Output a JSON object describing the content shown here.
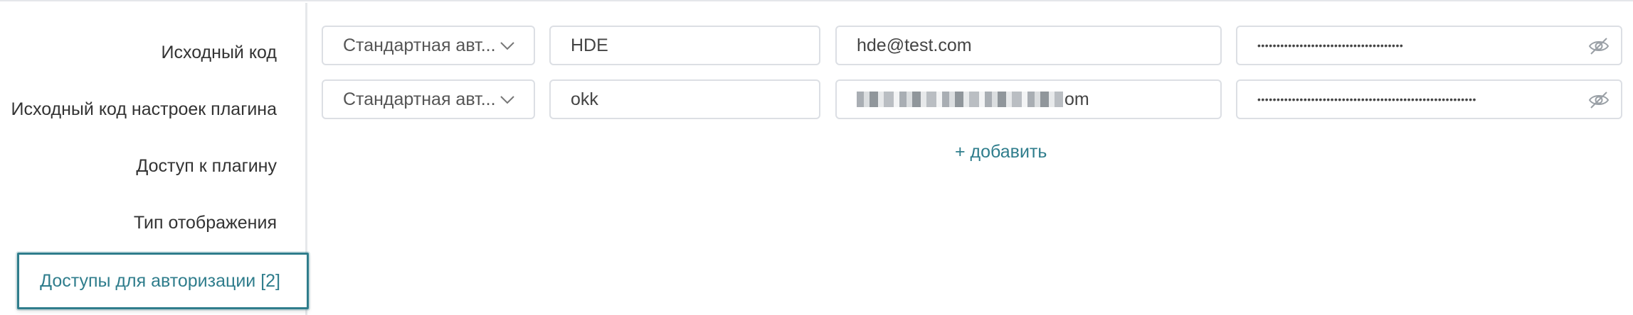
{
  "nav": {
    "items": [
      {
        "label": "Исходный код"
      },
      {
        "label": "Исходный код настроек плагина"
      },
      {
        "label": "Доступ к плагину"
      },
      {
        "label": "Тип отображения"
      }
    ],
    "active_label": "Доступы для авторизации [2]"
  },
  "credentials": [
    {
      "auth_type": "Стандартная авт...",
      "name": "HDE",
      "login": "hde@test.com",
      "password_mask": "••••••••••••••••••••••••••••••••••••••",
      "password_icon": "eye-slash-icon"
    },
    {
      "auth_type": "Стандартная авт...",
      "name": "okk",
      "login_suffix": "om",
      "password_mask": "•••••••••••••••••••••••••••••••••••••••••••••••••••••••••",
      "password_icon": "eye-slash-icon"
    }
  ],
  "add_label": "+ добавить",
  "colors": {
    "accent": "#2f7d8c",
    "border": "#dcdfe4"
  }
}
